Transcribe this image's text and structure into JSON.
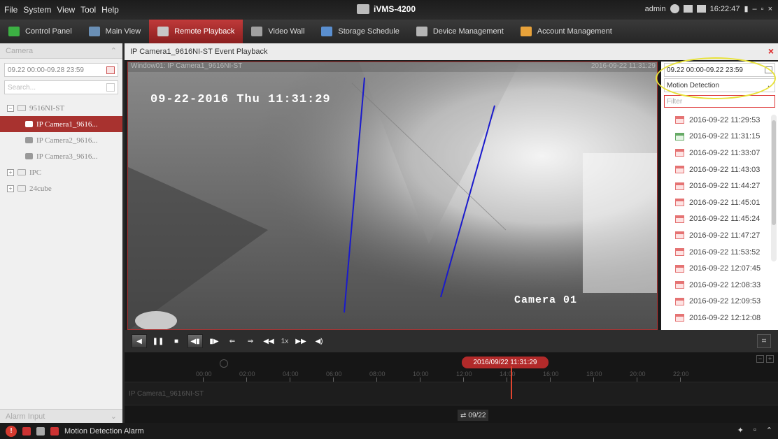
{
  "menu": [
    "File",
    "System",
    "View",
    "Tool",
    "Help"
  ],
  "app_title": "iVMS-4200",
  "system": {
    "user": "admin",
    "time": "16:22:47"
  },
  "modules": [
    {
      "label": "Control Panel",
      "icon": "control-panel-icon",
      "color": "#3cb043"
    },
    {
      "label": "Main View",
      "icon": "main-view-icon",
      "color": "#6a8fb5"
    },
    {
      "label": "Remote Playback",
      "icon": "remote-playback-icon",
      "color": "#c7c7c7"
    },
    {
      "label": "Video Wall",
      "icon": "video-wall-icon",
      "color": "#a0a0a0"
    },
    {
      "label": "Storage Schedule",
      "icon": "storage-schedule-icon",
      "color": "#5a8fd0"
    },
    {
      "label": "Device Management",
      "icon": "device-management-icon",
      "color": "#b5b5b5"
    },
    {
      "label": "Account Management",
      "icon": "account-management-icon",
      "color": "#e8a23a"
    }
  ],
  "active_module": "Remote Playback",
  "left_panel": {
    "header": "Camera",
    "date_range": "09.22 00:00-09.28 23:59",
    "search_placeholder": "Search...",
    "tree": [
      {
        "label": "9516NI-ST",
        "type": "device",
        "expand": "−"
      },
      {
        "label": "IP Camera1_9616...",
        "type": "camera",
        "selected": true
      },
      {
        "label": "IP Camera2_9616...",
        "type": "camera"
      },
      {
        "label": "IP Camera3_9616...",
        "type": "camera"
      },
      {
        "label": "IPC",
        "type": "group",
        "expand": "+"
      },
      {
        "label": "24cube",
        "type": "group",
        "expand": "+"
      }
    ],
    "footer": "Alarm Input"
  },
  "main": {
    "title": "IP Camera1_9616NI-ST Event Playback",
    "window_label": "Window01: IP Camera1_9616NI-ST",
    "window_time": "2016-09-22 11:31:29",
    "osd_timestamp": "09-22-2016 Thu 11:31:29",
    "osd_camera": "Camera 01"
  },
  "right_panel": {
    "date_range": "09.22 00:00-09.22 23:59",
    "event_type": "Motion Detection",
    "filter_placeholder": "Filter",
    "events": [
      {
        "time": "2016-09-22 11:29:53",
        "status": "red"
      },
      {
        "time": "2016-09-22 11:31:15",
        "status": "green"
      },
      {
        "time": "2016-09-22 11:33:07",
        "status": "red"
      },
      {
        "time": "2016-09-22 11:43:03",
        "status": "red"
      },
      {
        "time": "2016-09-22 11:44:27",
        "status": "red"
      },
      {
        "time": "2016-09-22 11:45:01",
        "status": "red"
      },
      {
        "time": "2016-09-22 11:45:24",
        "status": "red"
      },
      {
        "time": "2016-09-22 11:47:27",
        "status": "red"
      },
      {
        "time": "2016-09-22 11:53:52",
        "status": "red"
      },
      {
        "time": "2016-09-22 12:07:45",
        "status": "red"
      },
      {
        "time": "2016-09-22 12:08:33",
        "status": "red"
      },
      {
        "time": "2016-09-22 12:09:53",
        "status": "red"
      },
      {
        "time": "2016-09-22 12:12:08",
        "status": "red"
      }
    ]
  },
  "controls": {
    "speed": "1x"
  },
  "timeline": {
    "current": "2016/09/22 11:31:29",
    "channel": "IP Camera1_9616NI-ST",
    "ticks": [
      "00:00",
      "02:00",
      "04:00",
      "06:00",
      "08:00",
      "10:00",
      "12:00",
      "14:00",
      "16:00",
      "18:00",
      "20:00",
      "22:00"
    ],
    "date": "09/22"
  },
  "status_bar": {
    "label": "Motion Detection Alarm"
  },
  "colors": {
    "accent": "#b22a2a",
    "highlight_ellipse": "#e8e23a",
    "motion_line": "#1a1acc"
  }
}
